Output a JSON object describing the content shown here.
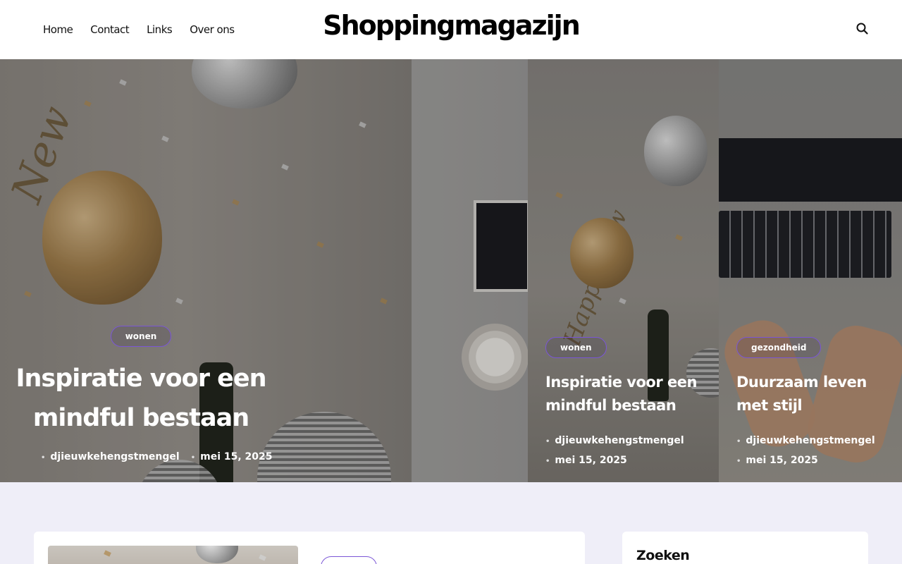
{
  "header": {
    "nav": [
      "Home",
      "Contact",
      "Links",
      "Over ons"
    ],
    "brand": "Shoppingmagazijn",
    "search_icon": "search-icon"
  },
  "hero": {
    "main": {
      "category": "wonen",
      "title": "Inspiratie voor een mindful bestaan",
      "author": "djieuwkehengstmengel",
      "date": "mei 15, 2025"
    },
    "cards": [
      {
        "category": "wonen",
        "title": "Inspiratie voor een mindful bestaan",
        "author": "djieuwkehengstmengel",
        "date": "mei 15, 2025"
      },
      {
        "category": "gezondheid",
        "title": "Duurzaam leven met stijl",
        "author": "djieuwkehengstmengel",
        "date": "mei 15, 2025"
      }
    ]
  },
  "sidebar": {
    "search_title": "Zoeken"
  },
  "colors": {
    "accent": "#7b56d6",
    "page_bg": "#efeef8"
  }
}
